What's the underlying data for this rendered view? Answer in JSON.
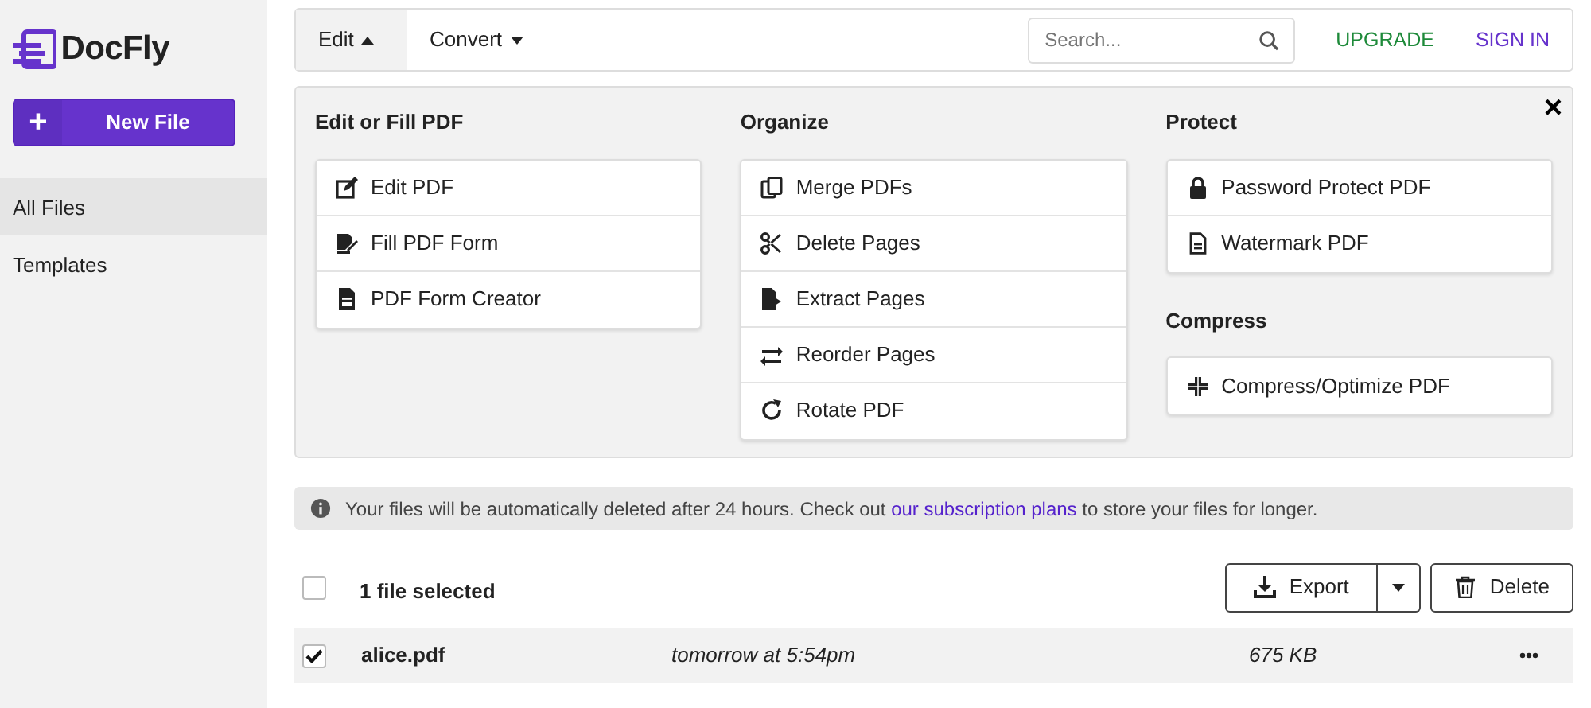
{
  "brand": {
    "name": "DocFly"
  },
  "new_file_button": {
    "icon_text": "+",
    "label": "New File"
  },
  "sidebar": {
    "items": [
      {
        "label": "All Files",
        "selected": true
      },
      {
        "label": "Templates",
        "selected": false
      }
    ]
  },
  "topnav": {
    "tabs": [
      {
        "label": "Edit",
        "expanded": true
      },
      {
        "label": "Convert",
        "expanded": false
      }
    ],
    "search": {
      "placeholder": "Search..."
    },
    "upgrade": "UPGRADE",
    "sign_in": "SIGN IN"
  },
  "menu": {
    "close": "×",
    "columns": [
      {
        "sections": [
          {
            "title": "Edit or Fill PDF",
            "items": [
              "Edit PDF",
              "Fill PDF Form",
              "PDF Form Creator"
            ]
          }
        ]
      },
      {
        "sections": [
          {
            "title": "Organize",
            "items": [
              "Merge PDFs",
              "Delete Pages",
              "Extract Pages",
              "Reorder Pages",
              "Rotate PDF"
            ]
          }
        ]
      },
      {
        "sections": [
          {
            "title": "Protect",
            "items": [
              "Password Protect PDF",
              "Watermark PDF"
            ]
          },
          {
            "title": "Compress",
            "items": [
              "Compress/Optimize PDF"
            ]
          }
        ]
      }
    ]
  },
  "notice": {
    "text_before": "Your files will be automatically deleted after 24 hours. Check out",
    "link": "our subscription plans",
    "text_after": "to store your files for longer."
  },
  "selection": {
    "checked": false,
    "label": "1 file selected",
    "export": "Export",
    "delete": "Delete"
  },
  "files": [
    {
      "name": "alice.pdf",
      "expires": "tomorrow at 5:54pm",
      "size": "675 KB",
      "checked": true,
      "selected": true
    }
  ]
}
